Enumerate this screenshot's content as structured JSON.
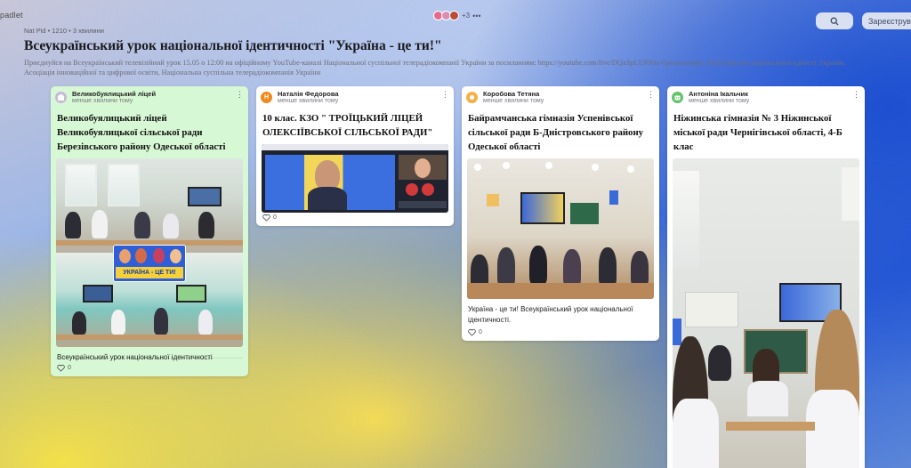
{
  "app": {
    "brand": "padlet",
    "search_icon": "search-icon",
    "register_label": "Зареєструва",
    "collaborators_more": "+3"
  },
  "board": {
    "meta": "Nat Pid • 1210 • 3 хвилини",
    "title": "Всеукраїнський урок національної ідентичності \"Україна - це ти!\"",
    "description": "Приєднуйся на Всеукраїнський телевізійний урок 15.05 о 12:00 на офіційному YouTube-каналі Національної суспільної телерадіокомпанії України за посиланням: https://youtube.com/live/DQxSpLUPS0o Організатори: Міністерство національної єдності України, Асоціація інноваційної та цифрової освіти, Національна суспільна телерадіокомпанія України"
  },
  "posts": [
    {
      "author": "Великобуялицький ліцей",
      "time": "менше хвилини тому",
      "title": "Великобуялицький ліцей Великобуялицької сільської ради Березівського району Одеської області",
      "caption": "Всеукраїнський урок національної ідентичності",
      "likes": "0",
      "overlay": "УКРАЇНА - ЦЕ ТИ!"
    },
    {
      "author": "Наталія Федорова",
      "avatar_letter": "Н",
      "time": "менше хвилини тому",
      "title": "10 клас. КЗО \" ТРОЇЦЬКИЙ ЛІЦЕЙ ОЛЕКСІЇВСЬКОЇ СІЛЬСЬКОЇ РАДИ\"",
      "likes": "0"
    },
    {
      "author": "Коробова Тетяна",
      "time": "менше хвилини тому",
      "title": "Байрамчанська гімназія Успенівської сільської ради Б-Дністровського району Одеської області",
      "caption": "Україна - це ти! Всеукраїнський урок національної ідентичності.",
      "likes": "0"
    },
    {
      "author": "Антоніна Ікальчик",
      "time": "менше хвилини тому",
      "title": "Ніжинська гімназія № 3 Ніжинської міської ради Чернігівської області, 4-Б клас"
    }
  ],
  "colors": {
    "green_card": "#d7f8d4",
    "accent_ukraine_blue": "#1d4fd0",
    "accent_ukraine_yellow": "#f4e04a"
  }
}
